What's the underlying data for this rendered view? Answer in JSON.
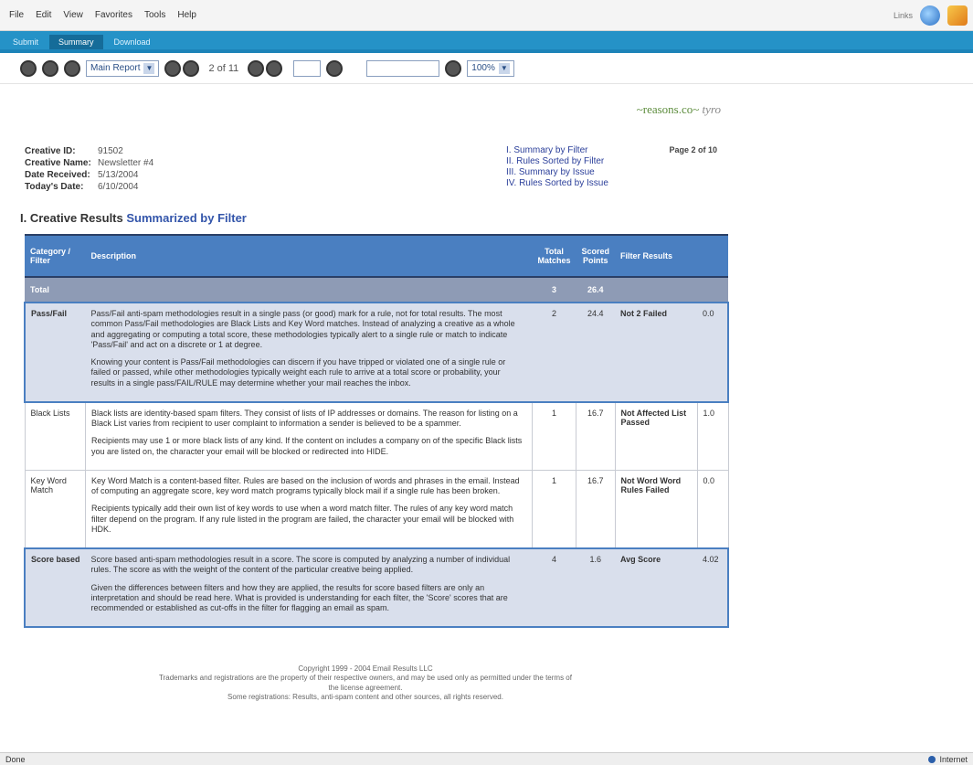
{
  "menubar": {
    "items": [
      "File",
      "Edit",
      "View",
      "Favorites",
      "Tools",
      "Help"
    ],
    "user": "Links"
  },
  "tabs": [
    "Submit",
    "Summary",
    "Download"
  ],
  "toolbar": {
    "report_select": "Main Report",
    "pager": "2 of 11",
    "zoom": "100%"
  },
  "brand": {
    "logo": "~reasons.co~",
    "logo_suffix": "tyro"
  },
  "info": {
    "fields": [
      {
        "label": "Creative ID:",
        "value": "91502"
      },
      {
        "label": "Creative Name:",
        "value": "Newsletter #4"
      },
      {
        "label": "Date Received:",
        "value": "5/13/2004"
      },
      {
        "label": "Today's Date:",
        "value": "6/10/2004"
      }
    ],
    "links": [
      "I.  Summary by Filter",
      "II. Rules Sorted by Filter",
      "III. Summary by Issue",
      "IV. Rules Sorted by Issue"
    ],
    "page": "Page 2 of 10"
  },
  "section": {
    "number": "I.",
    "title_plain": "Creative Results",
    "title_accent": "Summarized by Filter"
  },
  "table": {
    "headers": {
      "category": "Category / Filter",
      "description": "Description",
      "total": "Total Matches",
      "scored": "Scored Points",
      "results": "Filter Results"
    },
    "total_row": {
      "label": "Total",
      "total": "3",
      "scored": "26.4"
    },
    "rows": [
      {
        "category": "Pass/Fail",
        "paragraphs": [
          "Pass/Fail anti-spam methodologies result in a single pass (or good) mark for a rule, not for total results. The most common Pass/Fail methodologies are Black Lists and Key Word matches. Instead of analyzing a creative as a whole and aggregating or computing a total score, these methodologies typically alert to a single rule or match to indicate 'Pass/Fail' and act on a discrete or 1 at degree.",
          "Knowing your content is Pass/Fail methodologies can discern if you have tripped or violated one of a single rule or failed or passed, while other methodologies typically weight each rule to arrive at a total score or probability, your results in a single pass/FAIL/RULE may determine whether your mail reaches the inbox."
        ],
        "total": "2",
        "scored": "24.4",
        "result": "Not 2 Failed",
        "points": "0.0"
      },
      {
        "category": "Black Lists",
        "paragraphs": [
          "Black lists are identity-based spam filters. They consist of lists of IP addresses or domains. The reason for listing on a Black List varies from recipient to user complaint to information a sender is believed to be a spammer.",
          "Recipients may use 1 or more black lists of any kind. If the content on includes a company on of the specific Black lists you are listed on, the character your email will be blocked or redirected into HIDE."
        ],
        "total": "1",
        "scored": "16.7",
        "result": "Not Affected List Passed",
        "points": "1.0"
      },
      {
        "category": "Key Word Match",
        "paragraphs": [
          "Key Word Match is a content-based filter. Rules are based on the inclusion of words and phrases in the email. Instead of computing an aggregate score, key word match programs typically block mail if a single rule has been broken.",
          "Recipients typically add their own list of key words to use when a word match filter. The rules of any key word match filter depend on the program. If any rule listed in the program are failed, the character your email will be blocked with HDK."
        ],
        "total": "1",
        "scored": "16.7",
        "result": "Not Word Word Rules Failed",
        "points": "0.0"
      },
      {
        "category": "Score based",
        "paragraphs": [
          "Score based anti-spam methodologies result in a score. The score is computed by analyzing a number of individual rules. The score as with the weight of the content of the particular creative being applied.",
          "Given the differences between filters and how they are applied, the results for score based filters are only an interpretation and should be read here. What is provided is understanding for each filter, the 'Score' scores that are recommended or established as cut-offs in the filter for flagging an email as spam."
        ],
        "total": "4",
        "scored": "1.6",
        "result": "Avg Score",
        "points": "4.02"
      }
    ]
  },
  "footer": {
    "line1": "Copyright 1999 - 2004 Email Results LLC",
    "line2": "Trademarks and registrations are the property of their respective owners, and may be used only as permitted under the terms of the license agreement.",
    "line3": "Some registrations: Results, anti-spam content and other sources, all rights reserved."
  },
  "statusbar": {
    "left": "Done",
    "right": "Internet"
  }
}
